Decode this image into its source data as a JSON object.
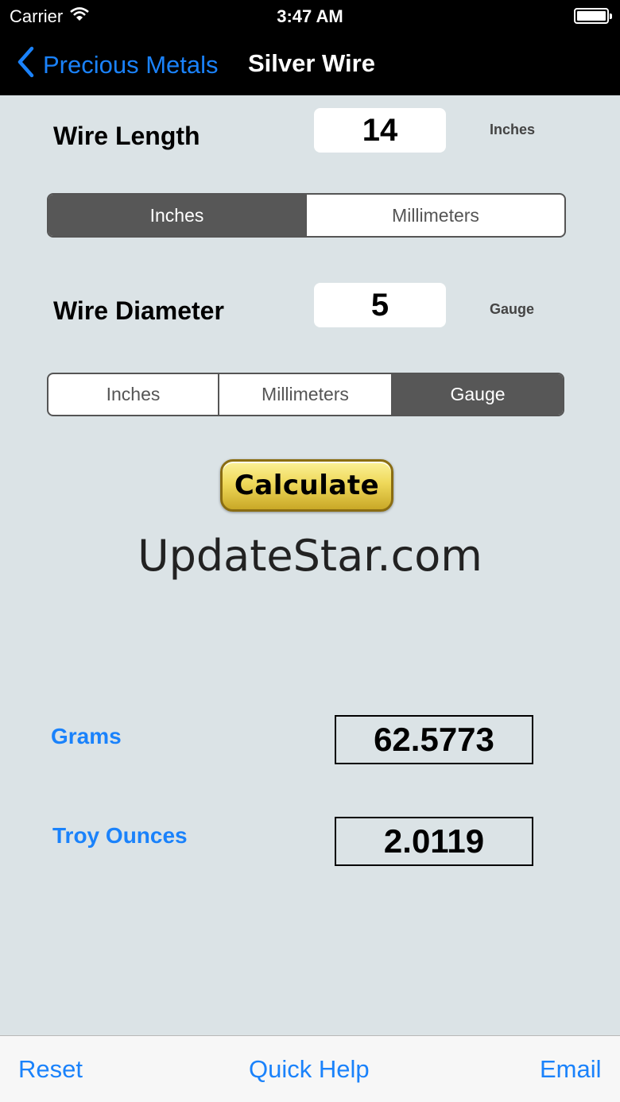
{
  "status_bar": {
    "carrier": "Carrier",
    "time": "3:47 AM"
  },
  "nav": {
    "back_label": "Precious Metals",
    "title": "Silver Wire"
  },
  "wire_length": {
    "label": "Wire Length",
    "value": "14",
    "unit": "Inches",
    "segments": [
      "Inches",
      "Millimeters"
    ]
  },
  "wire_diameter": {
    "label": "Wire Diameter",
    "value": "5",
    "unit": "Gauge",
    "segments": [
      "Inches",
      "Millimeters",
      "Gauge"
    ]
  },
  "calculate_label": "Calculate",
  "watermark": "UpdateStar.com",
  "results": {
    "grams_label": "Grams",
    "grams_value": "62.5773",
    "troy_label": "Troy Ounces",
    "troy_value": "2.0119"
  },
  "toolbar": {
    "reset": "Reset",
    "quick_help": "Quick Help",
    "email": "Email"
  },
  "colors": {
    "accent": "#1a82fb",
    "background": "#dbe3e6",
    "segment_active": "#575757"
  }
}
